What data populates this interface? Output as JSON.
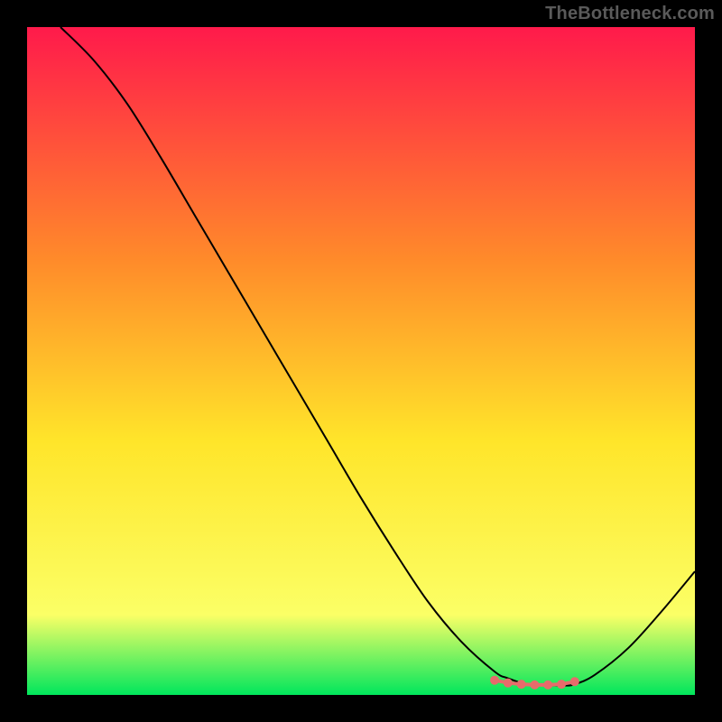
{
  "watermark": "TheBottleneck.com",
  "chart_data": {
    "type": "line",
    "title": "",
    "xlabel": "",
    "ylabel": "",
    "xlim": [
      0,
      100
    ],
    "ylim": [
      0,
      100
    ],
    "grid": false,
    "legend": false,
    "background_gradient": {
      "top": "#ff1a4b",
      "mid1": "#ff8b2a",
      "mid2": "#ffe52a",
      "mid3": "#fbff66",
      "bottom": "#00e65c"
    },
    "series": [
      {
        "name": "curve",
        "color": "#000000",
        "stroke_width": 2,
        "x": [
          5,
          10,
          15,
          20,
          25,
          30,
          35,
          40,
          45,
          50,
          55,
          60,
          65,
          70,
          72,
          75,
          80,
          82,
          85,
          90,
          95,
          100
        ],
        "y": [
          100,
          95,
          88.5,
          80.5,
          72,
          63.5,
          55,
          46.5,
          38,
          29.5,
          21.5,
          14,
          8,
          3.5,
          2.5,
          1.6,
          1.4,
          1.6,
          3,
          7,
          12.5,
          18.5
        ]
      }
    ],
    "highlight": {
      "name": "flat-segment-markers",
      "color": "#e76b6b",
      "marker_radius": 5,
      "stroke_width": 4,
      "x": [
        70,
        72,
        74,
        76,
        78,
        80,
        82
      ],
      "y": [
        2.2,
        1.8,
        1.6,
        1.5,
        1.5,
        1.6,
        2.0
      ]
    }
  }
}
